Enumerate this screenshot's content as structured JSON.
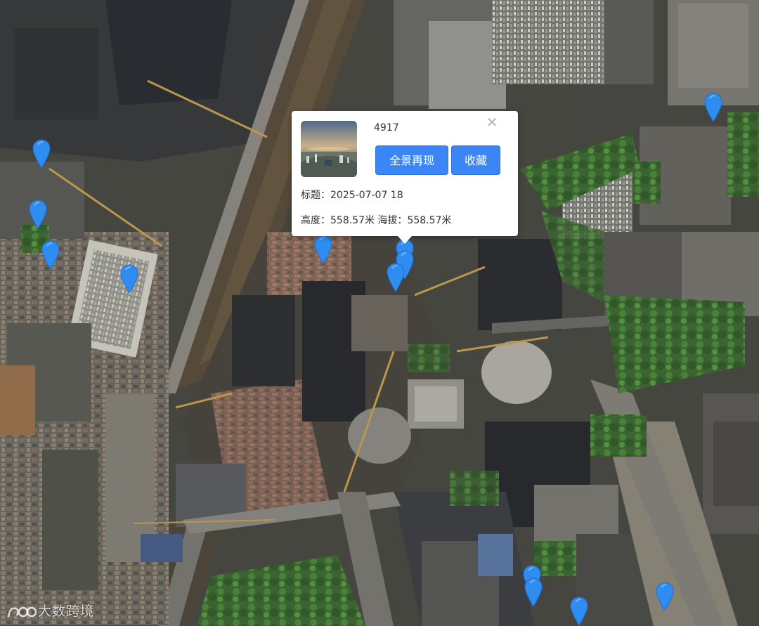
{
  "map": {
    "markers": [
      {
        "name": "marker-1"
      },
      {
        "name": "marker-2"
      },
      {
        "name": "marker-3"
      },
      {
        "name": "marker-4"
      },
      {
        "name": "marker-5"
      },
      {
        "name": "marker-6"
      },
      {
        "name": "marker-7"
      },
      {
        "name": "marker-8"
      },
      {
        "name": "marker-9"
      },
      {
        "name": "marker-10"
      },
      {
        "name": "marker-11"
      },
      {
        "name": "marker-12"
      },
      {
        "name": "marker-13"
      }
    ],
    "marker_color": "#2f8cf0"
  },
  "popup": {
    "id": "4917",
    "close_icon": "close-icon",
    "pano_button": "全景再现",
    "favorite_button": "收藏",
    "title_line": "标题：2025-07-07 18",
    "height_line": "高度：558.57米 海拔：558.57米"
  },
  "watermark": {
    "text": "大数跨境",
    "logo_icon": "brand-logo-icon"
  },
  "colors": {
    "accent": "#3a86f7"
  }
}
